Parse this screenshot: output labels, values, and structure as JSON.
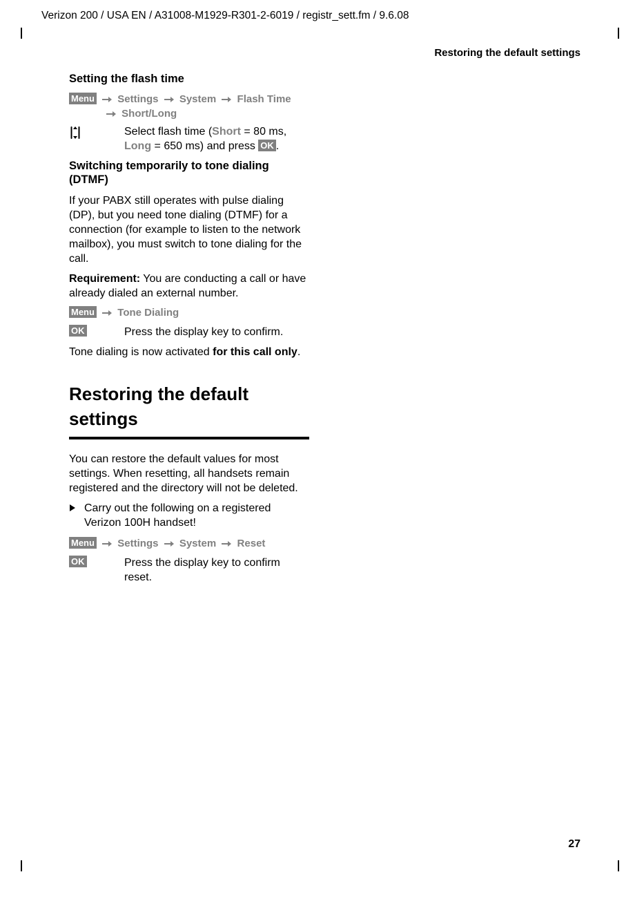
{
  "header_path": "Verizon 200 / USA EN / A31008-M1929-R301-2-6019 / registr_sett.fm / 9.6.08",
  "running_head": "Restoring the default settings",
  "page_number": "27",
  "labels": {
    "menu": "Menu",
    "ok": "OK"
  },
  "flash": {
    "heading": "Setting the flash time",
    "path_settings": "Settings",
    "path_system": "System",
    "path_flashtime": "Flash Time",
    "path_shortlong": "Short/Long",
    "step_pre": "Select flash time (",
    "step_short": "Short",
    "step_mid1": " = 80 ms, ",
    "step_long": "Long",
    "step_mid2": " = 650 ms) and press ",
    "step_post": "."
  },
  "dtmf": {
    "heading": "Switching temporarily to tone dialing (DTMF)",
    "para1": "If your PABX still operates with pulse dialing (DP), but you need tone dialing (DTMF) for a connection (for example to listen to the network mailbox), you must switch to tone dialing for the call.",
    "req_label": "Requirement:",
    "req_text": " You are conducting a call or have already dialed an external number.",
    "path_tonedialing": "Tone Dialing",
    "ok_text": "Press the display key to confirm.",
    "result_pre": "Tone dialing is now activated ",
    "result_bold": "for this call only",
    "result_post": "."
  },
  "restore": {
    "title": "Restoring the default settings",
    "para1": "You can restore the default values for most settings. When resetting, all handsets remain registered and the directory will not be deleted.",
    "bullet": "Carry out the following on a registered Verizon 100H handset!",
    "path_settings": "Settings",
    "path_system": "System",
    "path_reset": "Reset",
    "ok_text": "Press the display key to confirm reset."
  }
}
